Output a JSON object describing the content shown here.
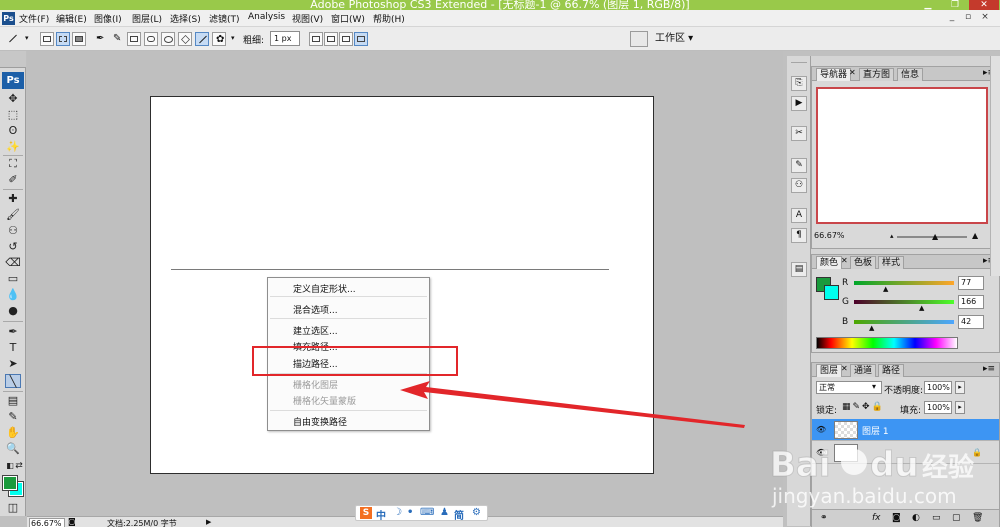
{
  "window": {
    "title": "Adobe Photoshop CS3 Extended - [无标题-1 @ 66.7% (图层 1, RGB/8)]"
  },
  "menu": [
    "文件(F)",
    "编辑(E)",
    "图像(I)",
    "图层(L)",
    "选择(S)",
    "滤镜(T)",
    "Analysis",
    "视图(V)",
    "窗口(W)",
    "帮助(H)"
  ],
  "options": {
    "weight_label": "粗细:",
    "weight_value": "1 px",
    "workspace": "工作区 ▾"
  },
  "context_menu": {
    "items": [
      "定义自定形状...",
      "混合选项...",
      "建立选区...",
      "填充路径...",
      "描边路径...",
      "栅格化图层",
      "栅格化矢量蒙版",
      "自由变换路径"
    ],
    "highlighted": "描边路径..."
  },
  "status": {
    "zoom": "66.67%",
    "doc": "文档:2.25M/0 字节"
  },
  "ime": {
    "items": [
      "中",
      "简"
    ]
  },
  "navigator": {
    "tabs": [
      "导航器",
      "直方图",
      "信息"
    ],
    "zoom": "66.67%"
  },
  "color": {
    "tabs": [
      "颜色",
      "色板",
      "样式"
    ],
    "R": {
      "label": "R",
      "value": "77"
    },
    "G": {
      "label": "G",
      "value": "166"
    },
    "B": {
      "label": "B",
      "value": "42"
    },
    "fg": "#1a9a3c",
    "bg": "#00ffee"
  },
  "layers": {
    "tabs": [
      "图层",
      "通道",
      "路径"
    ],
    "blend_mode": "正常",
    "opacity_label": "不透明度:",
    "opacity": "100%",
    "lock_label": "锁定:",
    "fill_label": "填充:",
    "fill": "100%",
    "rows": [
      {
        "name": "图层 1",
        "active": true
      },
      {
        "name": "",
        "active": false
      }
    ]
  },
  "watermark": {
    "brand": "Bai du 经验",
    "url": "jingyan.baidu.com"
  }
}
